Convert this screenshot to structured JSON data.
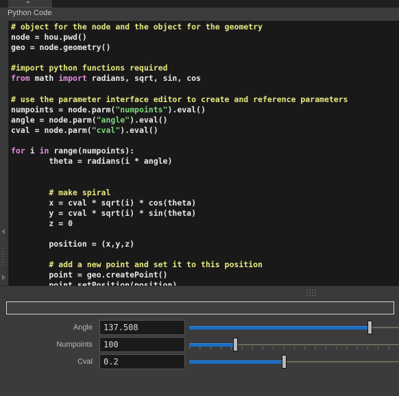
{
  "window": {
    "tab_caret_icon": "caret-down-icon"
  },
  "panel": {
    "title": "Python Code"
  },
  "editor": {
    "language": "python",
    "lines": [
      [
        {
          "t": "# object for the node and the object for the geometry",
          "c": "cmt"
        }
      ],
      [
        {
          "t": "node = hou.pwd()",
          "c": "pln"
        }
      ],
      [
        {
          "t": "geo = node.geometry()",
          "c": "pln"
        }
      ],
      [],
      [
        {
          "t": "#import python functions required",
          "c": "cmt"
        }
      ],
      [
        {
          "t": "from",
          "c": "kw"
        },
        {
          "t": " math ",
          "c": "pln"
        },
        {
          "t": "import",
          "c": "kw"
        },
        {
          "t": " radians, sqrt, sin, cos",
          "c": "pln"
        }
      ],
      [],
      [
        {
          "t": "# use the parameter interface editor to create and reference parameters",
          "c": "cmt"
        }
      ],
      [
        {
          "t": "numpoints = node.parm(",
          "c": "pln"
        },
        {
          "t": "\"numpoints\"",
          "c": "str"
        },
        {
          "t": ").eval()",
          "c": "pln"
        }
      ],
      [
        {
          "t": "angle = node.parm(",
          "c": "pln"
        },
        {
          "t": "\"angle\"",
          "c": "str"
        },
        {
          "t": ").eval()",
          "c": "pln"
        }
      ],
      [
        {
          "t": "cval = node.parm(",
          "c": "pln"
        },
        {
          "t": "\"cval\"",
          "c": "str"
        },
        {
          "t": ").eval()",
          "c": "pln"
        }
      ],
      [],
      [
        {
          "t": "for",
          "c": "kw"
        },
        {
          "t": " i ",
          "c": "pln"
        },
        {
          "t": "in",
          "c": "kw"
        },
        {
          "t": " range(numpoints):",
          "c": "pln"
        }
      ],
      [
        {
          "t": "        theta = radians(i * angle)",
          "c": "pln"
        }
      ],
      [],
      [],
      [
        {
          "t": "        # make spiral",
          "c": "cmt"
        }
      ],
      [
        {
          "t": "        x = cval * sqrt(i) * cos(theta)",
          "c": "pln"
        }
      ],
      [
        {
          "t": "        y = cval * sqrt(i) * sin(theta)",
          "c": "pln"
        }
      ],
      [
        {
          "t": "        z = 0",
          "c": "pln"
        }
      ],
      [],
      [
        {
          "t": "        position = (x,y,z)",
          "c": "pln"
        }
      ],
      [],
      [
        {
          "t": "        # add a new point and set it to this position",
          "c": "cmt"
        }
      ],
      [
        {
          "t": "        point = geo.createPoint()",
          "c": "pln"
        }
      ],
      [
        {
          "t": "        point.setPosition(position)",
          "c": "pln"
        }
      ]
    ]
  },
  "params": {
    "path_value": "",
    "path_placeholder": "",
    "rows": [
      {
        "label": "Angle",
        "value": "137.508",
        "slider_percent": 86,
        "ticks": false
      },
      {
        "label": "Numpoints",
        "value": "100",
        "slider_percent": 22,
        "ticks": true
      },
      {
        "label": "Cval",
        "value": "0.2",
        "slider_percent": 45,
        "ticks": false
      }
    ]
  },
  "colors": {
    "accent_slider": "#1a6cc4",
    "comment": "#e7e97f",
    "keyword": "#e48ce4",
    "string": "#7fd87f",
    "code_bg": "#191919",
    "panel_bg": "#3b3b3b"
  }
}
